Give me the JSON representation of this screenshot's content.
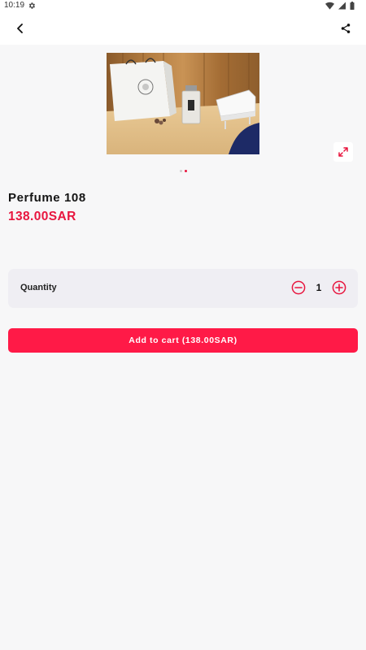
{
  "status_bar": {
    "time": "10:19",
    "icons": [
      "gear-icon",
      "wifi-icon",
      "signal-icon",
      "battery-icon"
    ]
  },
  "app_bar": {
    "back_icon": "back-arrow-icon",
    "share_icon": "share-icon"
  },
  "gallery": {
    "image_description": "perfume",
    "expand_icon": "expand-icon",
    "slide_count": 2,
    "active_slide": 2
  },
  "product": {
    "name": "Perfume 108",
    "price": "138.00SAR"
  },
  "quantity": {
    "label": "Quantity",
    "value": "1",
    "decrease_icon": "minus-circle-icon",
    "increase_icon": "plus-circle-icon"
  },
  "cart": {
    "button_label": "Add to cart (138.00SAR)"
  },
  "colors": {
    "accent": "#e8163f",
    "button": "#ff1a47",
    "background": "#f7f7f8",
    "card": "#efeef3"
  }
}
